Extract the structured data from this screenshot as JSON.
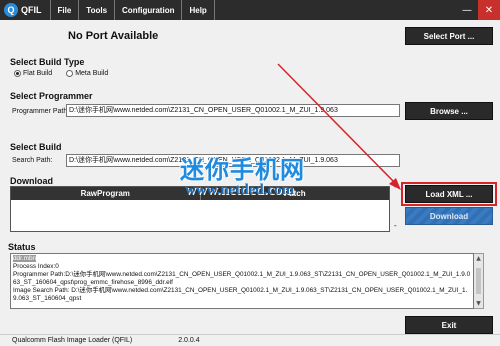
{
  "titlebar": {
    "app_name": "QFIL",
    "menu": [
      "File",
      "Tools",
      "Configuration",
      "Help"
    ],
    "minimize": "—",
    "close": "✕"
  },
  "port": {
    "status": "No Port Available",
    "select_port_label": "Select Port ..."
  },
  "build_type": {
    "heading": "Select Build Type",
    "options": [
      {
        "label": "Flat Build",
        "selected": true
      },
      {
        "label": "Meta Build",
        "selected": false
      }
    ]
  },
  "programmer": {
    "heading": "Select Programmer",
    "field_label": "Programmer Path:",
    "value": "D:\\迷你手机网\\www.netded.com\\Z2131_CN_OPEN_USER_Q01002.1_M_ZUI_1.9.063",
    "browse_label": "Browse ..."
  },
  "select_build": {
    "heading": "Select Build",
    "field_label": "Search Path:",
    "value": "D:\\迷你手机网\\www.netded.com\\Z2131_CN_OPEN_USER_Q01002.1_M_ZUI_1.9.063"
  },
  "download": {
    "heading": "Download",
    "columns": [
      "RawProgram",
      "Patch"
    ],
    "load_xml_label": "Load XML ...",
    "download_label": "Download",
    "side_marks": [
      "-",
      "-"
    ]
  },
  "status": {
    "heading": "Status",
    "lines": [
      "ddr.mbn",
      "Process Index:0",
      "Programmer Path:D:\\迷你手机网\\www.netded.com\\Z2131_CN_OPEN_USER_Q01002.1_M_ZUI_1.9.063_ST\\Z2131_CN_OPEN_USER_Q01002.1_M_ZUI_1.9.063_ST_160604_qpst\\prog_emmc_firehose_8996_ddr.elf",
      "Image Search Path: D:\\迷你手机网\\www.netded.com\\Z2131_CN_OPEN_USER_Q01002.1_M_ZUI_1.9.063_ST\\Z2131_CN_OPEN_USER_Q01002.1_M_ZUI_1.9.063_ST_160604_qpst"
    ]
  },
  "exit_label": "Exit",
  "footer": {
    "app_full_name": "Qualcomm Flash Image Loader (QFIL)",
    "version": "2.0.0.4"
  },
  "watermark": {
    "text": "迷你手机网",
    "url": "www.netded.com"
  },
  "colors": {
    "titlebar": "#2c2c2c",
    "accent_blue": "#3a7cc4",
    "highlight_red": "#d9232a",
    "close_red": "#c8302c"
  }
}
